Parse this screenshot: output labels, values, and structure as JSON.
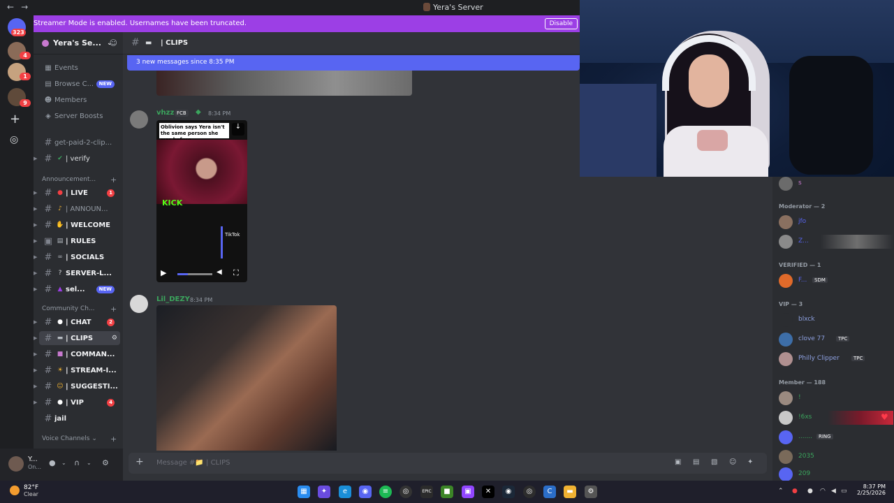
{
  "window": {
    "title": "Yera's Server"
  },
  "rail": {
    "unread_badge": "323",
    "badges": [
      "4",
      "1",
      "9"
    ]
  },
  "banner": {
    "message": "Streamer Mode is enabled. Usernames have been truncated.",
    "disable_label": "Disable"
  },
  "server": {
    "name": "Yera's Se..."
  },
  "sidebar": {
    "top_items": [
      {
        "label": "Events"
      },
      {
        "label": "Browse C...",
        "badge": "NEW"
      },
      {
        "label": "Members"
      },
      {
        "label": "Server Boosts"
      }
    ],
    "channels_a": [
      {
        "label": "get-paid-2-clip..."
      },
      {
        "label": "| verify"
      }
    ],
    "category_announcements": "Announcement...",
    "channels_b": [
      {
        "label": "| LIVE",
        "count": "1"
      },
      {
        "label": "| ANNOUN..."
      },
      {
        "label": "| WELCOME"
      },
      {
        "label": "| RULES"
      },
      {
        "label": "| SOCIALS"
      },
      {
        "label": "SERVER-L..."
      },
      {
        "label": "sel...",
        "badge": "NEW"
      }
    ],
    "category_community": "Community Ch...",
    "channels_c": [
      {
        "label": "| CHAT",
        "count": "2"
      },
      {
        "label": "| CLIPS"
      },
      {
        "label": "| COMMAN..."
      },
      {
        "label": "| STREAM-I..."
      },
      {
        "label": "| SUGGESTI..."
      },
      {
        "label": "| VIP",
        "count": "4"
      },
      {
        "label": "jail"
      }
    ],
    "category_voice": "Voice Channels"
  },
  "user": {
    "name": "Y...",
    "status": "On..."
  },
  "channel": {
    "name": "| CLIPS"
  },
  "new_messages": "3 new messages since 8:35 PM",
  "messages": [
    {
      "author": "vhzz",
      "tag": "FCB",
      "time": "8:34 PM",
      "video": {
        "caption": "Oblivion says Yera isn't the same person she was before",
        "kick": "KICK",
        "tiktok": "TikTok",
        "progress": 0.3
      }
    },
    {
      "author": "Lil_DEZY",
      "time": "8:34 PM"
    }
  ],
  "composer": {
    "placeholder": "Message #📁 | CLIPS"
  },
  "members": {
    "top_member": "s",
    "groups": [
      {
        "title": "Moderator — 2",
        "items": [
          {
            "name": "jfo",
            "color": "#5865f2"
          },
          {
            "name": "Z...",
            "color": "#5865f2"
          }
        ]
      },
      {
        "title": "VERIFIED — 1",
        "items": [
          {
            "name": "F...",
            "tag": "SDM",
            "color": "#5865f2"
          }
        ]
      },
      {
        "title": "VIP — 3",
        "items": [
          {
            "name": "blxck",
            "color": "#8ea1e1"
          },
          {
            "name": "clove 77",
            "tag": "TPC",
            "color": "#8ea1e1"
          },
          {
            "name": "Philly Clipper",
            "tag": "TPC",
            "color": "#8ea1e1"
          }
        ]
      },
      {
        "title": "Member — 188",
        "items": [
          {
            "name": "!",
            "color": "#3ba55d"
          },
          {
            "name": "!6xs",
            "color": "#3ba55d"
          },
          {
            "name": ".......",
            "tag": "RING",
            "color": "#3ba55d"
          },
          {
            "name": "2035",
            "color": "#3ba55d"
          },
          {
            "name": "209",
            "color": "#3ba55d"
          }
        ]
      }
    ]
  },
  "weather": {
    "temp": "82°F",
    "cond": "Clear"
  },
  "clock": {
    "time": "8:37 PM",
    "date": "2/25/2026"
  },
  "colors": {
    "banner": "#9c3fe5",
    "blurple": "#5865f2",
    "online": "#3ba55d",
    "badge": "#f23f43"
  }
}
